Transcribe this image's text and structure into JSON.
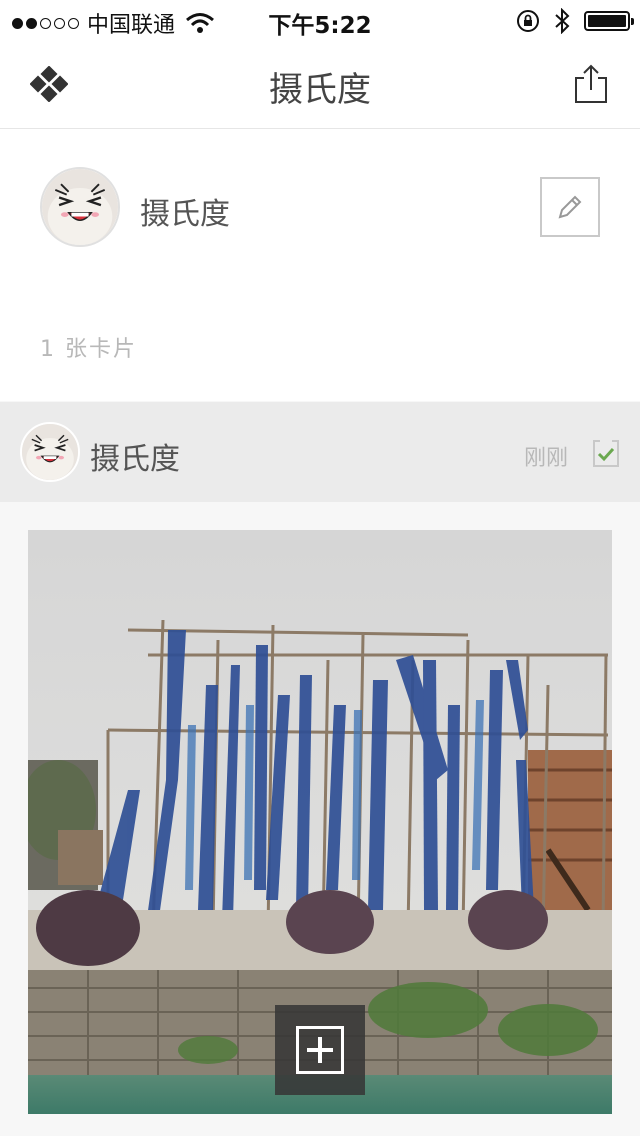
{
  "status_bar": {
    "carrier": "中国联通",
    "time": "下午5:22",
    "signal_dots_filled": 2,
    "signal_dots_total": 5,
    "icons": [
      "wifi-icon",
      "orientation-lock-icon",
      "bluetooth-icon",
      "battery-icon"
    ],
    "battery_level": 1.0
  },
  "nav": {
    "title": "摄氏度",
    "left_icon": "diamond-menu-icon",
    "right_icon": "share-icon"
  },
  "profile": {
    "name": "摄氏度",
    "card_count": "1 张卡片",
    "edit_icon": "pencil-icon"
  },
  "card": {
    "author": "摄氏度",
    "time": "刚刚",
    "checked": true,
    "add_icon": "add-icon"
  },
  "colors": {
    "accent_check": "#6aa84f",
    "header_bg": "#ebebeb",
    "muted_text": "#b8b8b8"
  }
}
